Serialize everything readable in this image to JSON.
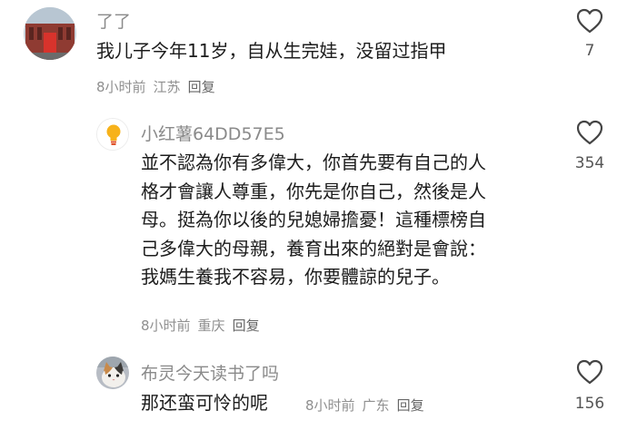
{
  "comments": [
    {
      "username": "了了",
      "text_lines": [
        "我儿子今年11岁，自从生完娃，没留过指甲"
      ],
      "time": "8小时前",
      "location": "江苏",
      "reply_label": "回复",
      "likes": "7"
    },
    {
      "username": "小红薯64DD57E5",
      "text_lines": [
        "並不認為你有多偉大，你首先要有自己的人",
        "格才會讓人尊重，你先是你自己，然後是人",
        "母。挺為你以後的兒媳婦擔憂！這種標榜自",
        "己多偉大的母親，養育出來的絕對是會說：",
        "我媽生養我不容易，你要體諒的兒子。"
      ],
      "time": "8小时前",
      "location": "重庆",
      "reply_label": "回复",
      "likes": "354"
    },
    {
      "username": "布灵今天读书了吗",
      "text_lines": [
        "那还蛮可怜的呢"
      ],
      "time": "8小时前",
      "location": "广东",
      "reply_label": "回复",
      "likes": "156"
    }
  ],
  "colors": {
    "username": "#8a8a8a",
    "text": "#1c1c1c",
    "meta": "#8f8f8f",
    "heart_outline": "#444444"
  }
}
